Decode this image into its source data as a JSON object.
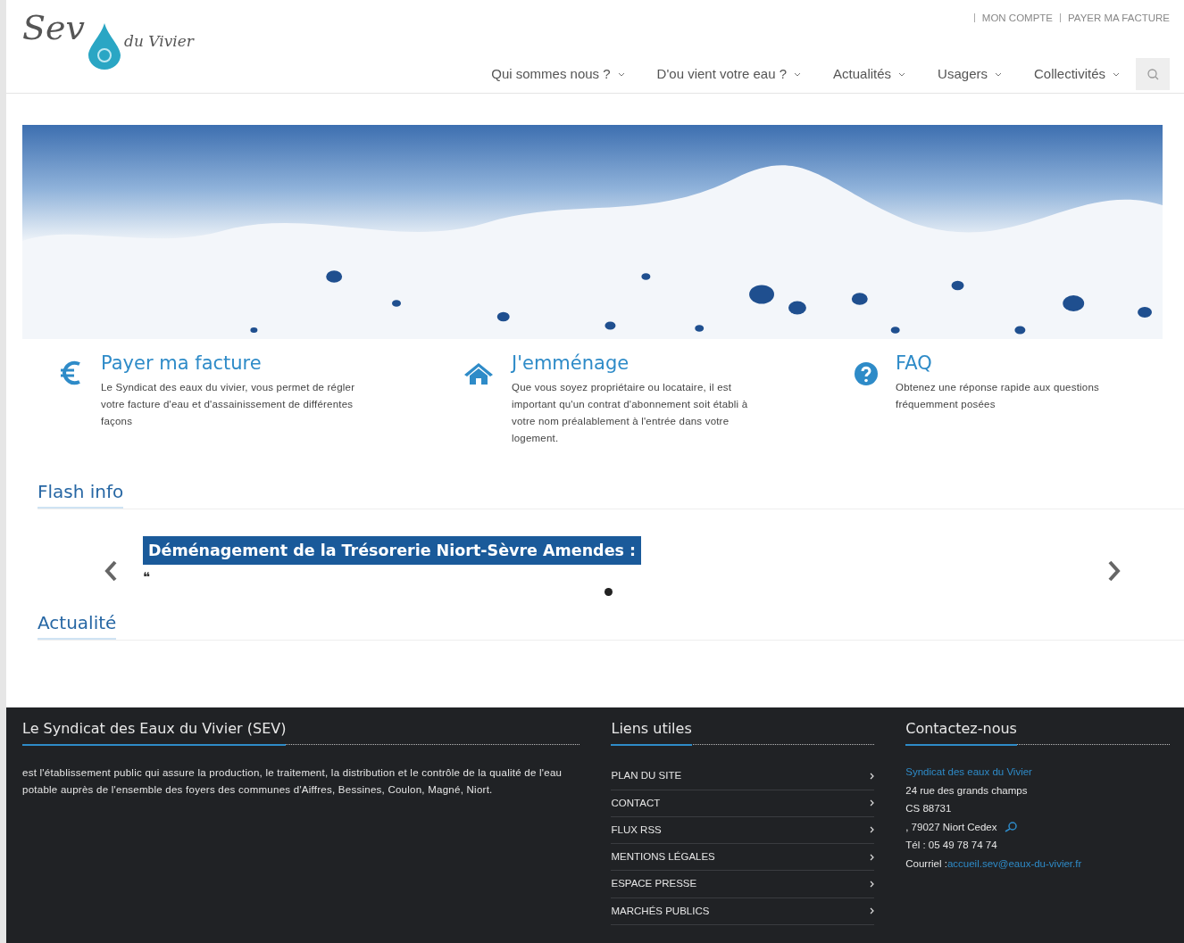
{
  "logo": {
    "main": "Sev",
    "sub": "du Vivier"
  },
  "top_links": [
    "MON COMPTE",
    "PAYER MA FACTURE"
  ],
  "nav": [
    {
      "label": "Qui sommes nous ?"
    },
    {
      "label": "D'ou vient votre eau ?"
    },
    {
      "label": "Actualités"
    },
    {
      "label": "Usagers"
    },
    {
      "label": "Collectivités"
    }
  ],
  "features": [
    {
      "kind": "euro",
      "title": "Payer ma facture",
      "text": "Le Syndicat des eaux du vivier, vous permet de régler votre facture d'eau et d'assainissement de différentes façons"
    },
    {
      "kind": "home",
      "title": "J'emménage",
      "text": "Que vous soyez propriétaire ou locataire, il est important qu'un contrat d'abonnement soit établi à votre nom préalablement à l'entrée dans votre logement."
    },
    {
      "kind": "question",
      "title": "FAQ",
      "text": "Obtenez une réponse rapide aux questions fréquemment posées"
    }
  ],
  "flash_info": {
    "heading": "Flash info",
    "slide_title": "Déménagement de la Trésorerie Niort-Sèvre Amendes :",
    "quote_mark": "❝",
    "indicators": [
      {
        "selected": true
      }
    ]
  },
  "news": {
    "heading": "Actualité"
  },
  "footer": {
    "about": {
      "heading": "Le Syndicat des Eaux du Vivier (SEV)",
      "text": "est l'établissement public qui assure la production, le traitement, la distribution et le contrôle de la qualité de l'eau potable auprès de l'ensemble des foyers des communes d'Aiffres, Bessines, Coulon, Magné, Niort."
    },
    "links": {
      "heading": "Liens utiles",
      "items": [
        "PLAN DU SITE",
        "CONTACT",
        "FLUX RSS",
        "MENTIONS LÉGALES",
        "ESPACE PRESSE",
        "MARCHÉS PUBLICS"
      ]
    },
    "contact": {
      "heading": "Contactez-nous",
      "name": "Syndicat des eaux du Vivier",
      "lines": [
        "24 rue des grands champs",
        "CS 88731",
        ", 79027 Niort Cedex"
      ],
      "phone": "Tél : 05 49 78 74 74",
      "email_label": "Courriel :",
      "email": "accueil.sev@eaux-du-vivier.fr"
    }
  }
}
